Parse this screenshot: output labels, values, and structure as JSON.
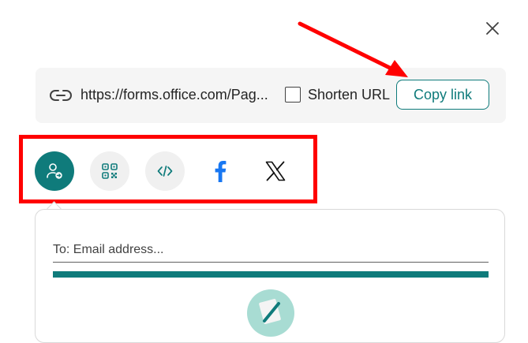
{
  "dialog": {
    "close_icon": "close-icon"
  },
  "link_bar": {
    "link_icon": "link-icon",
    "url": "https://forms.office.com/Pag...",
    "shorten_label": "Shorten URL",
    "shorten_checked": false,
    "copy_label": "Copy link"
  },
  "share_options": [
    {
      "icon": "share-with-people-icon",
      "selected": true
    },
    {
      "icon": "qr-code-icon",
      "selected": false
    },
    {
      "icon": "embed-code-icon",
      "selected": false
    },
    {
      "icon": "facebook-icon",
      "selected": false
    },
    {
      "icon": "x-twitter-icon",
      "selected": false
    }
  ],
  "email_panel": {
    "to_placeholder": "To: Email address..."
  },
  "colors": {
    "accent": "#0f7b7b",
    "annotation": "#ff0000",
    "facebook": "#1877f2"
  }
}
